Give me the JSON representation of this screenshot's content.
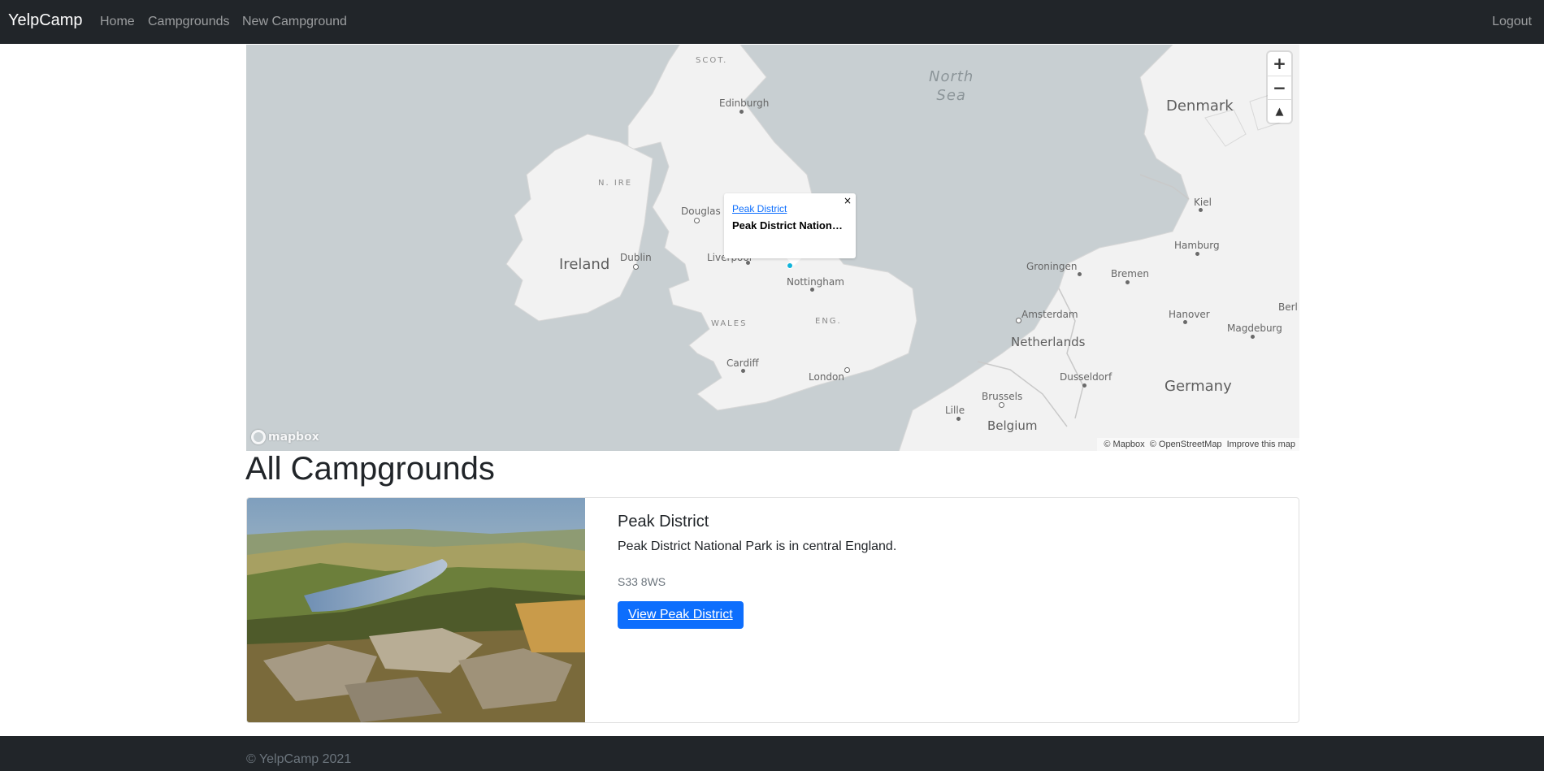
{
  "navbar": {
    "brand": "YelpCamp",
    "links": {
      "home": "Home",
      "campgrounds": "Campgrounds",
      "new_campground": "New Campground"
    },
    "logout": "Logout",
    "background": "#212529"
  },
  "map": {
    "labels": {
      "north_sea": "North\nSea",
      "scot": "SCOT.",
      "edinburgh": "Edinburgh",
      "n_ire": "N. IRE",
      "ireland": "Ireland",
      "dublin": "Dublin",
      "douglas": "Douglas",
      "liverpool": "Liverpool",
      "nottingham": "Nottingham",
      "wales": "WALES",
      "eng": "ENG.",
      "cardiff": "Cardiff",
      "london": "London",
      "denmark": "Denmark",
      "kiel": "Kiel",
      "hamburg": "Hamburg",
      "groningen": "Groningen",
      "bremen": "Bremen",
      "amsterdam": "Amsterdam",
      "netherlands": "Netherlands",
      "hanover": "Hanover",
      "magdeburg": "Magdeburg",
      "berl": "Berl",
      "dusseldorf": "Dusseldorf",
      "germany": "Germany",
      "brussels": "Brussels",
      "lille": "Lille",
      "belgium": "Belgium"
    },
    "popup": {
      "link": "Peak District",
      "description": "Peak District National Park is in central England."
    },
    "controls": {
      "zoom_in": "+",
      "zoom_out": "−",
      "compass": "▲"
    },
    "logo": "mapbox",
    "attribution": {
      "mapbox": "© Mapbox",
      "osm": "© OpenStreetMap",
      "improve": "Improve this map"
    },
    "marker_color": "#11b4da",
    "water_color": "#c8cfd2",
    "land_color": "#f2f2f2"
  },
  "main": {
    "title": "All Campgrounds",
    "campgrounds": [
      {
        "title": "Peak District",
        "description": "Peak District National Park is in central England.",
        "location": "S33 8WS",
        "button": "View Peak District"
      }
    ]
  },
  "footer": {
    "text": "© YelpCamp 2021"
  },
  "colors": {
    "primary": "#0d6efd",
    "muted": "#6c757d"
  }
}
